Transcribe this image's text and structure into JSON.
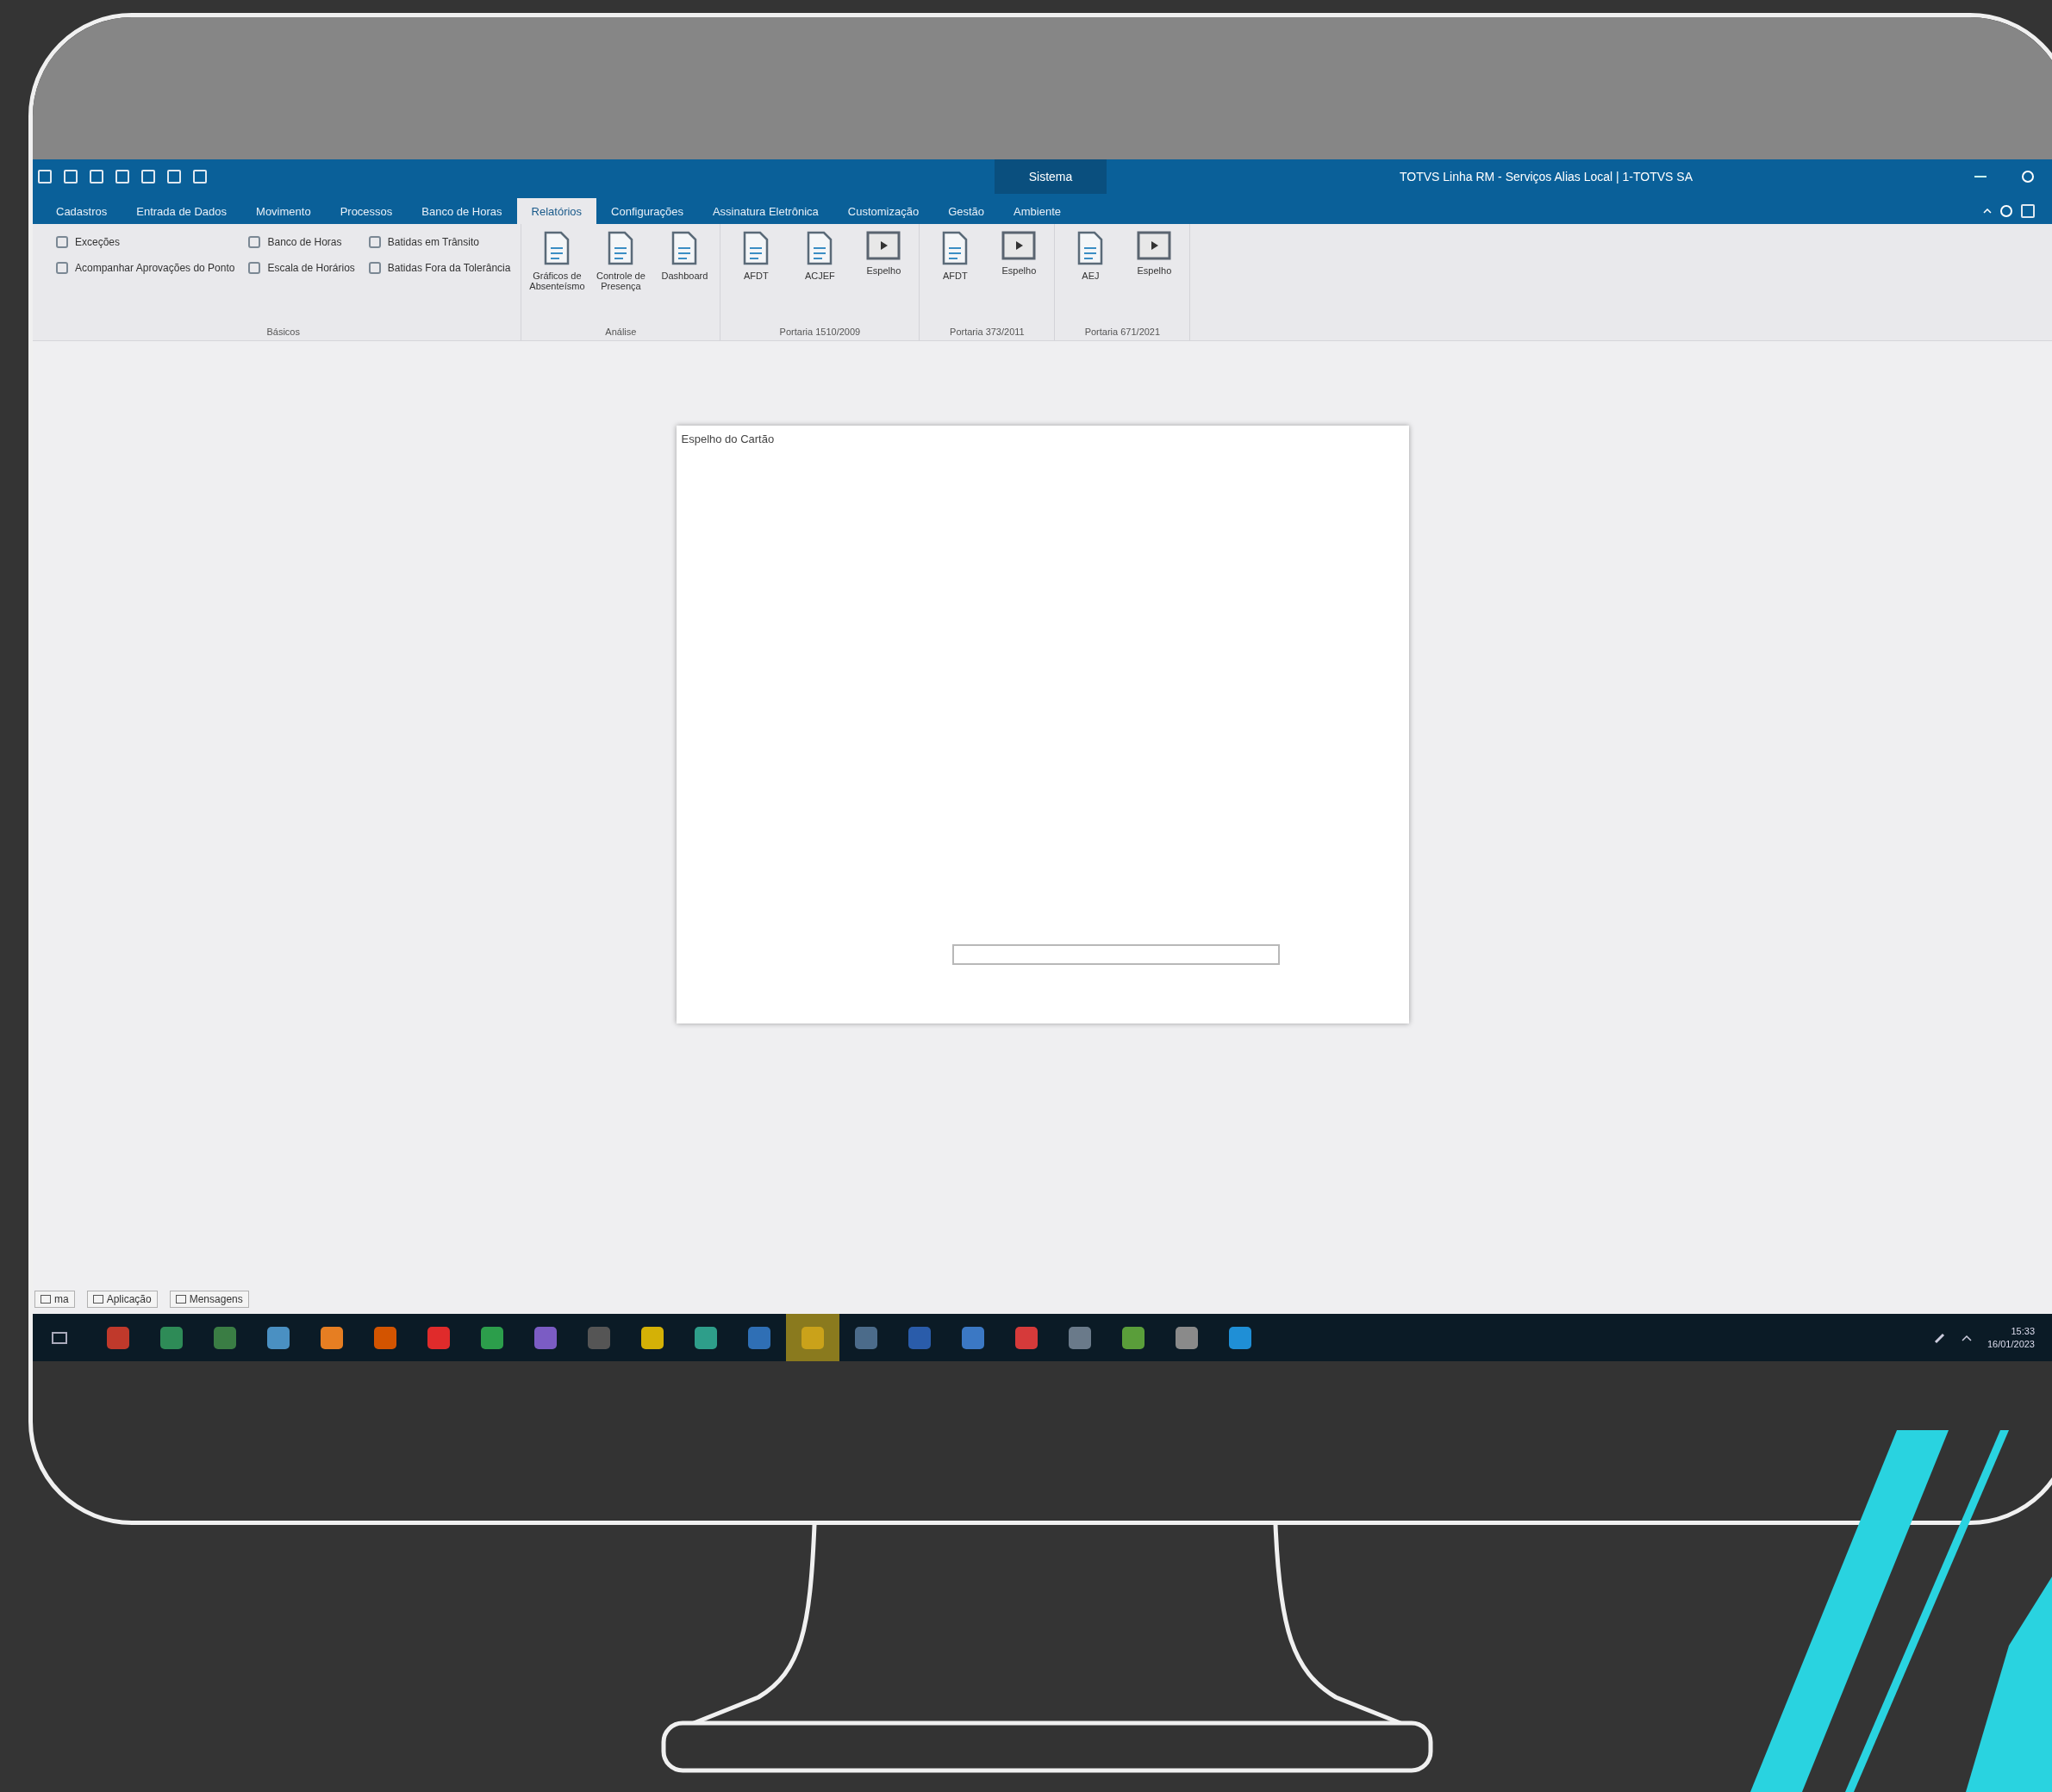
{
  "window": {
    "context_label": "Sistema",
    "title": "TOTVS Linha RM - Serviços Alias Local | 1-TOTVS SA"
  },
  "tabs": [
    {
      "label": "Cadastros",
      "selected": false
    },
    {
      "label": "Entrada de Dados",
      "selected": false
    },
    {
      "label": "Movimento",
      "selected": false
    },
    {
      "label": "Processos",
      "selected": false
    },
    {
      "label": "Banco de Horas",
      "selected": false
    },
    {
      "label": "Relatórios",
      "selected": true
    },
    {
      "label": "Configurações",
      "selected": false
    },
    {
      "label": "Assinatura Eletrônica",
      "selected": false
    },
    {
      "label": "Customização",
      "selected": false
    },
    {
      "label": "Gestão",
      "selected": false
    },
    {
      "label": "Ambiente",
      "selected": false
    }
  ],
  "ribbon_groups": [
    {
      "kind": "small",
      "title": "Básicos",
      "columns": [
        [
          {
            "label": "Exceções"
          },
          {
            "label": "Acompanhar Aprovações do Ponto"
          }
        ],
        [
          {
            "label": "Banco de Horas"
          },
          {
            "label": "Escala de Horários"
          }
        ],
        [
          {
            "label": "Batidas em Trânsito"
          },
          {
            "label": "Batidas Fora da Tolerância"
          }
        ]
      ]
    },
    {
      "kind": "large",
      "title": "Análise",
      "buttons": [
        {
          "label": "Gráficos de Absenteísmo",
          "kind": "doc"
        },
        {
          "label": "Controle de Presença",
          "kind": "doc"
        },
        {
          "label": "Dashboard",
          "kind": "doc"
        }
      ]
    },
    {
      "kind": "large",
      "title": "Portaria 1510/2009",
      "buttons": [
        {
          "label": "AFDT",
          "kind": "doc"
        },
        {
          "label": "ACJEF",
          "kind": "doc"
        },
        {
          "label": "Espelho",
          "kind": "screen"
        }
      ]
    },
    {
      "kind": "large",
      "title": "Portaria 373/2011",
      "buttons": [
        {
          "label": "AFDT",
          "kind": "doc"
        },
        {
          "label": "Espelho",
          "kind": "screen"
        }
      ]
    },
    {
      "kind": "large",
      "title": "Portaria 671/2021",
      "buttons": [
        {
          "label": "AEJ",
          "kind": "doc"
        },
        {
          "label": "Espelho",
          "kind": "screen"
        }
      ]
    }
  ],
  "dialog": {
    "title": "Espelho do Cartão",
    "progress": {
      "level": 0
    }
  },
  "status_tabs": [
    {
      "label": "ma"
    },
    {
      "label": "Aplicação"
    },
    {
      "label": "Mensagens"
    }
  ],
  "taskbar": {
    "apps": [
      {
        "selected": false
      },
      {
        "selected": false
      },
      {
        "selected": false
      },
      {
        "selected": false
      },
      {
        "selected": false
      },
      {
        "selected": false
      },
      {
        "selected": false
      },
      {
        "selected": false
      },
      {
        "selected": false
      },
      {
        "selected": false
      },
      {
        "selected": false
      },
      {
        "selected": false
      },
      {
        "selected": false
      },
      {
        "selected": true
      },
      {
        "selected": false
      },
      {
        "selected": false
      },
      {
        "selected": false
      },
      {
        "selected": false
      },
      {
        "selected": false
      },
      {
        "selected": false
      },
      {
        "selected": false
      },
      {
        "selected": false
      }
    ],
    "time": "15:33",
    "date": "16/01/2023"
  }
}
